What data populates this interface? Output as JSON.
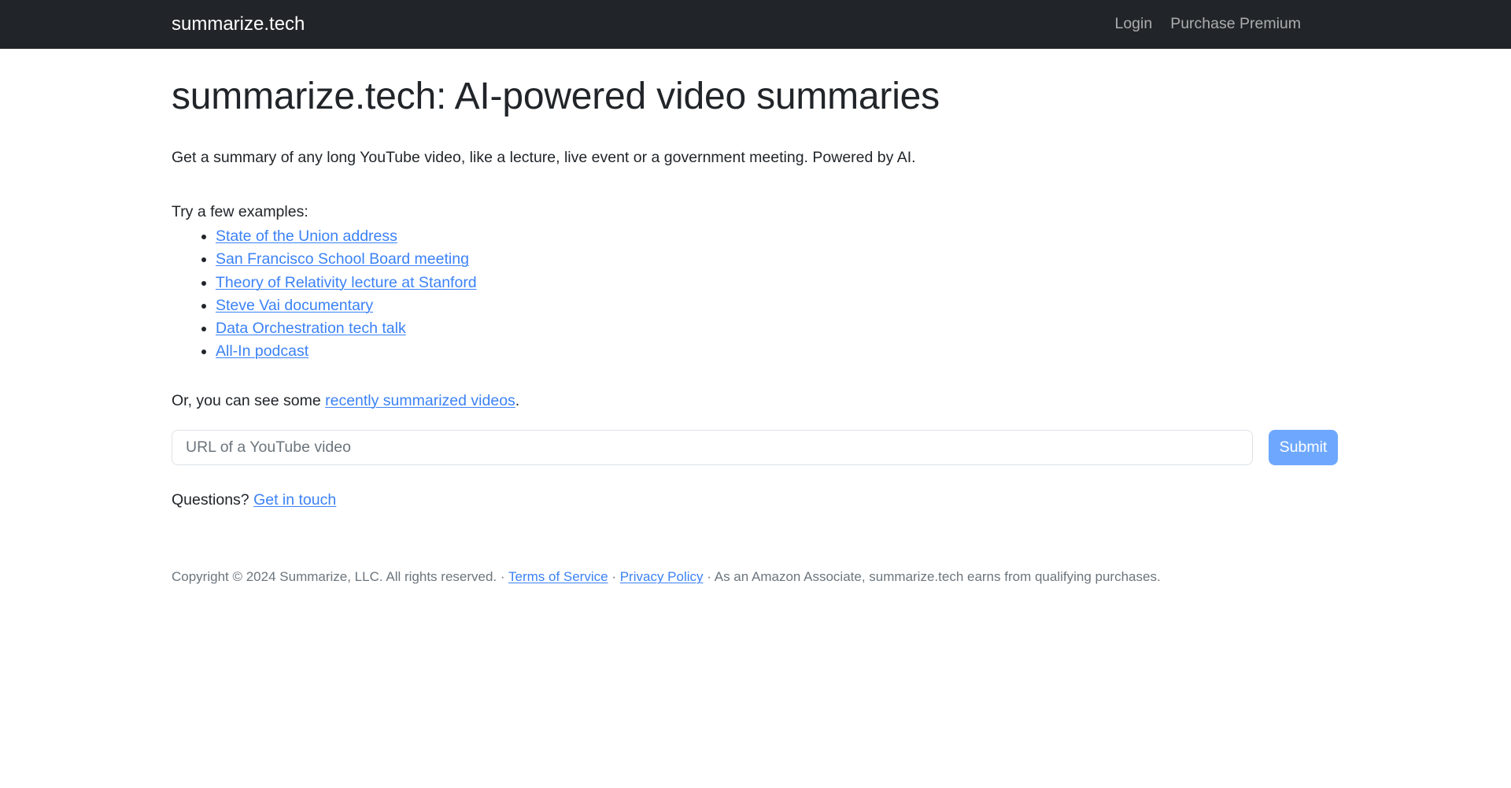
{
  "navbar": {
    "brand": "summarize.tech",
    "links": [
      {
        "label": "Login"
      },
      {
        "label": "Purchase Premium"
      }
    ],
    "background_color": "#212529"
  },
  "main": {
    "title": "summarize.tech: AI-powered video summaries",
    "lede": "Get a summary of any long YouTube video, like a lecture, live event or a government meeting. Powered by AI.",
    "examples_label": "Try a few examples:",
    "examples": [
      {
        "label": "State of the Union address"
      },
      {
        "label": "San Francisco School Board meeting"
      },
      {
        "label": "Theory of Relativity lecture at Stanford"
      },
      {
        "label": "Steve Vai documentary"
      },
      {
        "label": "Data Orchestration tech talk"
      },
      {
        "label": "All-In podcast"
      }
    ],
    "recent": {
      "prefix": "Or, you can see some ",
      "link_label": "recently summarized videos",
      "suffix": "."
    },
    "form": {
      "input_placeholder": "URL of a YouTube video",
      "input_value": "",
      "submit_label": "Submit"
    },
    "questions": {
      "prefix": "Questions? ",
      "link_label": "Get in touch"
    }
  },
  "footer": {
    "copyright": "Copyright © 2024 Summarize, LLC. All rights reserved.",
    "separator": "·",
    "terms_label": "Terms of Service",
    "privacy_label": "Privacy Policy",
    "amazon_notice": "As an Amazon Associate, summarize.tech earns from qualifying purchases."
  },
  "colors": {
    "link": "#3b82f6",
    "submit_button": "#6ea8fe",
    "navbar": "#212529",
    "muted_text": "#6c757d"
  }
}
